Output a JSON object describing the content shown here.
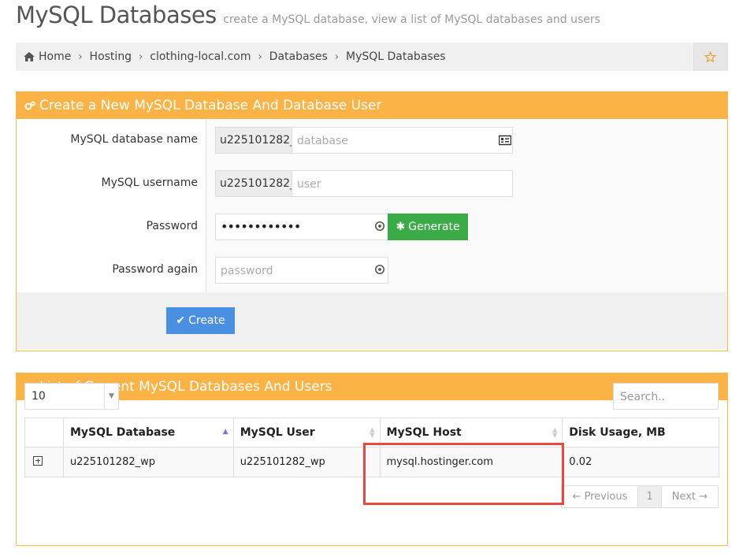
{
  "page": {
    "title": "MySQL Databases",
    "subtitle": "create a MySQL database, view a list of MySQL databases and users"
  },
  "breadcrumb": [
    "Home",
    "Hosting",
    "clothing-local.com",
    "Databases",
    "MySQL Databases"
  ],
  "create_panel": {
    "title": "Create a New MySQL Database And Database User",
    "db_name_label": "MySQL database name",
    "db_prefix": "u225101282_",
    "db_placeholder": "database",
    "username_label": "MySQL username",
    "user_prefix": "u225101282_",
    "user_placeholder": "user",
    "password_label": "Password",
    "password_value": "••••••••••••",
    "generate_label": "Generate",
    "password_again_label": "Password again",
    "password_again_placeholder": "password",
    "create_label": "Create"
  },
  "list_panel": {
    "title": "List of Current MySQL Databases And Users",
    "page_length": "10",
    "search_placeholder": "Search..",
    "columns": [
      "MySQL Database",
      "MySQL User",
      "MySQL Host",
      "Disk Usage, MB"
    ],
    "rows": [
      {
        "database": "u225101282_wp",
        "user": "u225101282_wp",
        "host": "mysql.hostinger.com",
        "disk": "0.02"
      }
    ],
    "pager": {
      "previous": "← Previous",
      "page": "1",
      "next": "Next →"
    }
  },
  "colors": {
    "panel_header": "#fbb346",
    "generate_button": "#3bab48",
    "create_button": "#4a90e2",
    "highlight": "#e8493e"
  }
}
